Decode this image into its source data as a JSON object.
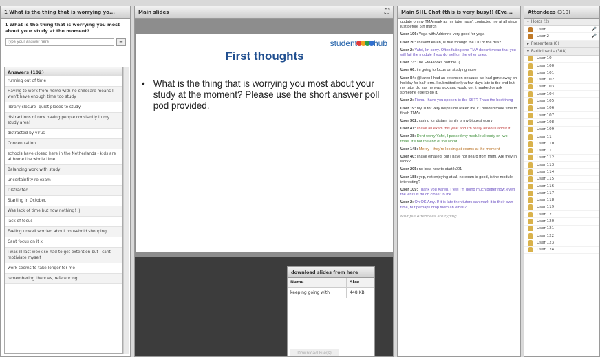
{
  "poll": {
    "header": "1 What is the thing that is worrying yo...",
    "question": "1 What is the thing that is worrying you most about your study at the moment?",
    "placeholder": "Type your answer here",
    "answers_header": "Answers (192)",
    "answers": [
      "running out of time",
      "Having to work from home with no childcare means I won't have enough time too study",
      "library closure- quiet places to study",
      "distractions of now having people constantly in my study area!",
      "distracted by virus",
      "Concentration",
      "schools have closed here in the Netherlands - kids are at home the whole time",
      "Balancing work with study",
      "uncertaintity re exam",
      "Distracted",
      "Starting in October.",
      "Was lack of time but now nothing! :)",
      "lack of focus",
      "Feeling unwell worried about household shopping",
      "Cant focus on it x",
      "i was ill last week so had to get extention but i cant motiviate myself",
      "work seems to take longer for me",
      "remembering theories, referencing"
    ]
  },
  "slides": {
    "header": "Main slides",
    "fullscreen_icon": "expand-icon",
    "logo_text_left": "student",
    "logo_text_right": "hub",
    "logo_colors": [
      "#e03a3a",
      "#f0a020",
      "#2a9d4a",
      "#2f6fd0"
    ],
    "title": "First thoughts",
    "bullet": "What is the thing that is worrying you most about your study at the moment? Please use the short answer poll pod provided."
  },
  "download": {
    "header": "download slides from here",
    "col_name": "Name",
    "col_size": "Size",
    "file_name": "keeping going with",
    "file_size": "448 KB",
    "button": "Download File(s)"
  },
  "chat": {
    "header": "Main SHL Chat (this is very busy!) (Eve...",
    "messages": [
      {
        "user": "",
        "text": "update on my TMA mark as my tutor hasn't contacted me at all since just before 5th march",
        "color": "black"
      },
      {
        "user": "User 196:",
        "text": " Yoga with Adrienne very good for yoga",
        "color": "black"
      },
      {
        "user": "User 20:",
        "text": " i havent karen, is that through the OU or the dsa?",
        "color": "black"
      },
      {
        "user": "User 2:",
        "text": " Yafei, Im sorry. Often failing one TMA doesnt mean that you will fail the module if you do well on the other ones.",
        "color": "purple"
      },
      {
        "user": "User 73:",
        "text": " The EMA looks horrible :(",
        "color": "black"
      },
      {
        "user": "User 66:",
        "text": " im going to focus on studying more",
        "color": "black"
      },
      {
        "user": "User 84:",
        "text": " @karen I had an extension because we had gone away on holiday for half term. I submitted only a few days late in the end but my tutor did say he was sick and would get it marked or ask someone else to do it.",
        "color": "black"
      },
      {
        "user": "User 2:",
        "text": " Fiona - have you spoken to the SST? Thats the best thing",
        "color": "purple"
      },
      {
        "user": "User 19:",
        "text": " My Tutor very helpful he asked me if I needed more time to finish TMAs",
        "color": "black"
      },
      {
        "user": "User 302:",
        "text": " caring for distant family is my biggest worry",
        "color": "black"
      },
      {
        "user": "User 41:",
        "text": " i have an exam this year and i'm really anxious about it",
        "color": "red"
      },
      {
        "user": "User 38:",
        "text": " Dont worry Yafei, I passed my module already on two tmas. It's not the end of the world.",
        "color": "green"
      },
      {
        "user": "User 148:",
        "text": " Mercy - they're looking at exams at the moment",
        "color": "orange"
      },
      {
        "user": "User 40:",
        "text": " i have emailed, but I have not heard from them. Are they in work?",
        "color": "black"
      },
      {
        "user": "User 205:",
        "text": " no idea how to start k001",
        "color": "black"
      },
      {
        "user": "User 188:",
        "text": " yep, not enjoying at all, no exam is good, is the module interesting?",
        "color": "black"
      },
      {
        "user": "User 109:",
        "text": " Thank you Karen. I feel I'm doing much better now, even the virus is much closer to me.",
        "color": "purple"
      },
      {
        "user": "User 2:",
        "text": " Oh OK Amy. If it is late then tutors can mark it in their own time, but perhaps drop them an email?",
        "color": "purple"
      }
    ],
    "typing": "Multiple Attendees are typing"
  },
  "attendees": {
    "header": "Attendees",
    "header_count": "(310)",
    "hosts_label": "Hosts (2)",
    "hosts": [
      "User 1",
      "User 2"
    ],
    "presenters_label": "Presenters (0)",
    "participants_label": "Participants (308)",
    "participants": [
      "User 10",
      "User 100",
      "User 101",
      "User 102",
      "User 103",
      "User 104",
      "User 105",
      "User 106",
      "User 107",
      "User 108",
      "User 109",
      "User 11",
      "User 110",
      "User 111",
      "User 112",
      "User 113",
      "User 114",
      "User 115",
      "User 116",
      "User 117",
      "User 118",
      "User 119",
      "User 12",
      "User 120",
      "User 121",
      "User 122",
      "User 123",
      "User 124"
    ]
  }
}
